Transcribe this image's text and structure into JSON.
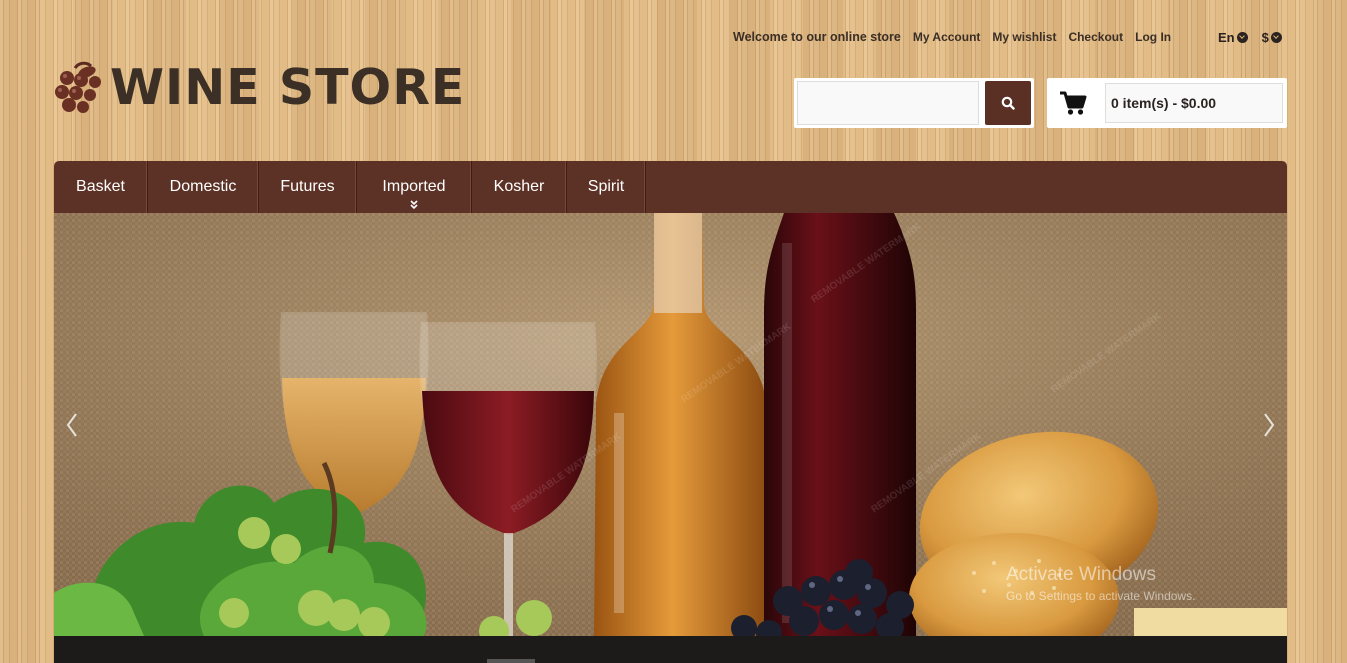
{
  "top_bar": {
    "welcome": "Welcome to our online store",
    "links": [
      "My Account",
      "My wishlist",
      "Checkout",
      "Log In"
    ],
    "language": "En",
    "currency": "$"
  },
  "logo": {
    "text": "WINE STORE",
    "icon": "grapes-icon"
  },
  "search": {
    "placeholder": "",
    "button_icon": "search-icon"
  },
  "cart": {
    "icon": "shopping-cart-icon",
    "summary": "0 item(s) - $0.00"
  },
  "nav": {
    "items": [
      {
        "label": "Basket",
        "has_submenu": false
      },
      {
        "label": "Domestic",
        "has_submenu": false
      },
      {
        "label": "Futures",
        "has_submenu": false
      },
      {
        "label": "Imported",
        "has_submenu": true
      },
      {
        "label": "Kosher",
        "has_submenu": false
      },
      {
        "label": "Spirit",
        "has_submenu": false
      }
    ]
  },
  "banner": {
    "watermark": "REMOVABLE WATERMARK",
    "prev_icon": "chevron-left-icon",
    "next_icon": "chevron-right-icon"
  },
  "os_overlay": {
    "title": "Activate Windows",
    "subtitle": "Go to Settings to activate Windows."
  },
  "colors": {
    "nav_background": "#5d3226",
    "search_button": "#5a3024",
    "logo_text": "#3b2f26",
    "page_wood": "#dcb27a"
  }
}
